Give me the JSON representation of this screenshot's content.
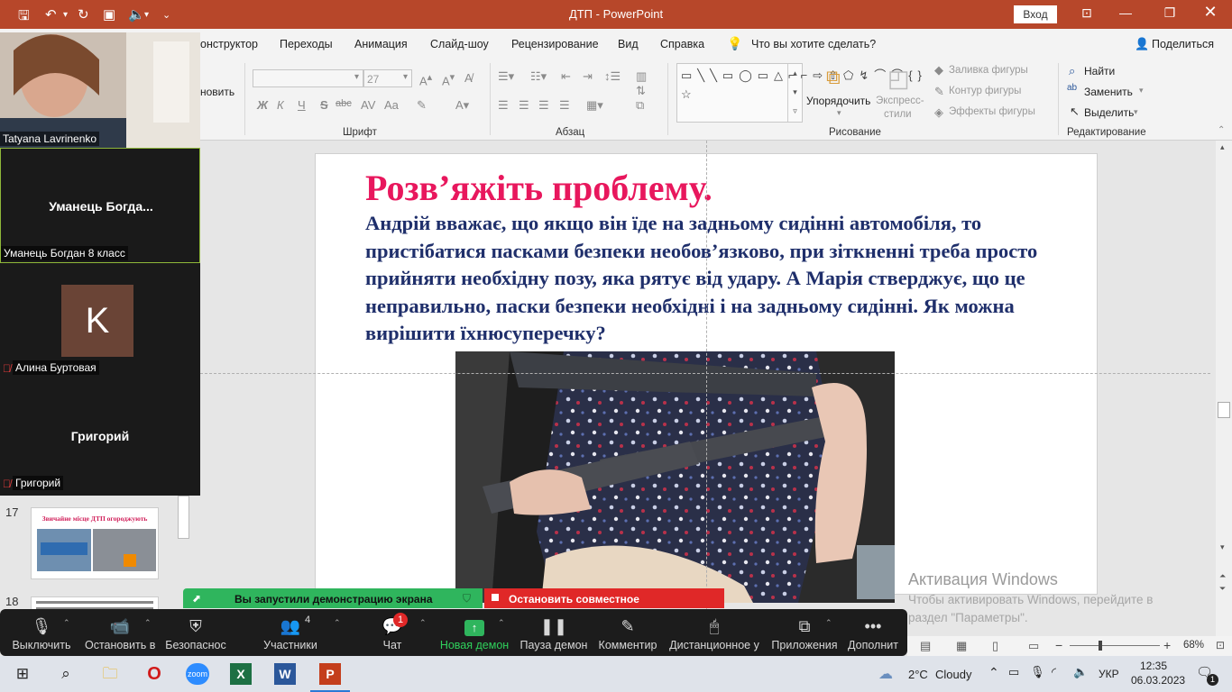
{
  "titlebar": {
    "title": "ДТП  -  PowerPoint",
    "signin": "Вход"
  },
  "menu": {
    "tabs": [
      "Конструктор",
      "Переходы",
      "Анимация",
      "Слайд-шоу",
      "Рецензирование",
      "Вид",
      "Справка"
    ],
    "tab0_visible": "онструктор",
    "search": "Что вы хотите сделать?",
    "share": "Поделиться"
  },
  "ribbon": {
    "clipboard_fragment": "новить",
    "font_name": "",
    "font_size": "27",
    "group_font": "Шрифт",
    "group_paragraph": "Абзац",
    "group_drawing": "Рисование",
    "group_editing": "Редактирование",
    "arrange": "Упорядочить",
    "quick_styles_1": "Экспресс-",
    "quick_styles_2": "стили",
    "shape_fill": "Заливка фигуры",
    "shape_outline": "Контур фигуры",
    "shape_effects": "Эффекты фигуры",
    "find": "Найти",
    "replace": "Заменить",
    "select": "Выделить",
    "bold": "Ж",
    "italic": "К",
    "underline": "Ч",
    "strike": "S",
    "abc": "abc",
    "aa": "Aa"
  },
  "slide": {
    "title": "Розв’яжіть проблему.",
    "body": "Андрій вважає, що якщо він їде на задньому сидінні автомобіля, то пристібатися пасками безпеки необов’язково, при зіткненні треба просто прийняти необхідну позу, яка рятує від удару. А Марія стверджує, що це неправильно, паски безпеки необхідні і на задньому сидінні. Як можна вирішити їхнюсуперечку?"
  },
  "thumbnails": [
    {
      "number": "17",
      "caption": "Звичайне місце ДТП огороджують"
    },
    {
      "number": "18",
      "caption": ""
    }
  ],
  "zoom_panel": {
    "participants": [
      {
        "name": "Tatyana Lavrinenko",
        "big": ""
      },
      {
        "name": "Уманець Богдан 8 класс",
        "big": "Уманець  Богда..."
      },
      {
        "name": "Алина Буртовая",
        "big": "K"
      },
      {
        "name": "Григорий",
        "big": "Григорий"
      }
    ]
  },
  "share_banner": {
    "started": "Вы запустили демонстрацию экрана",
    "stop": "Остановить совместное использование"
  },
  "zoom_toolbar": {
    "mute": "Выключить",
    "video": "Остановить в",
    "security": "Безопаснос",
    "participants": "Участники",
    "participants_count": "4",
    "chat": "Чат",
    "chat_badge": "1",
    "new_share": "Новая демон",
    "pause_share": "Пауза демон",
    "annotate": "Комментир",
    "remote": "Дистанционное у",
    "apps": "Приложения",
    "more": "Дополнит"
  },
  "activation": {
    "title": "Активация Windows",
    "line1": "Чтобы активировать Windows, перейдите в",
    "line2": "раздел \"Параметры\"."
  },
  "statusbar": {
    "zoom": "68%"
  },
  "taskbar": {
    "weather_temp": "2°C",
    "weather_text": "Cloudy",
    "language": "УКР",
    "time": "12:35",
    "date": "06.03.2023",
    "notifications": "1"
  }
}
